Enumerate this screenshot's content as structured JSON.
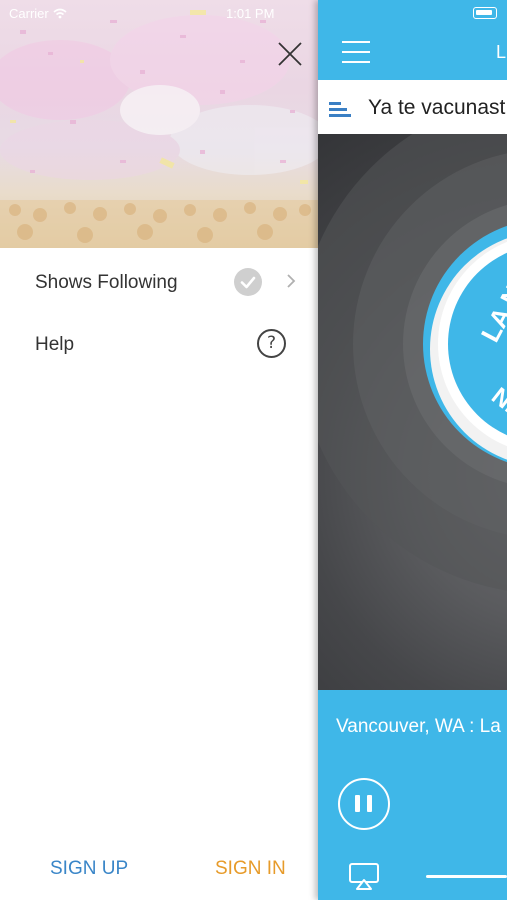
{
  "status_bar": {
    "carrier": "Carrier",
    "time": "1:01 PM"
  },
  "drawer": {
    "menu": [
      {
        "label": "Shows Following",
        "icon": "check-circle-icon"
      },
      {
        "label": "Help",
        "icon": "question-circle-icon"
      }
    ],
    "sign_up": "SIGN UP",
    "sign_in": "SIGN IN"
  },
  "player": {
    "title_partial": "L",
    "now_playing": "Ya te vacunast",
    "location": "Vancouver, WA : La",
    "logo_text_top": "LA N",
    "logo_text_bottom": "NE"
  },
  "colors": {
    "accent": "#3fb7e8",
    "sign_up": "#3a86c8",
    "sign_in": "#e79b2a",
    "artwork_bg": "#4a4b4e"
  }
}
